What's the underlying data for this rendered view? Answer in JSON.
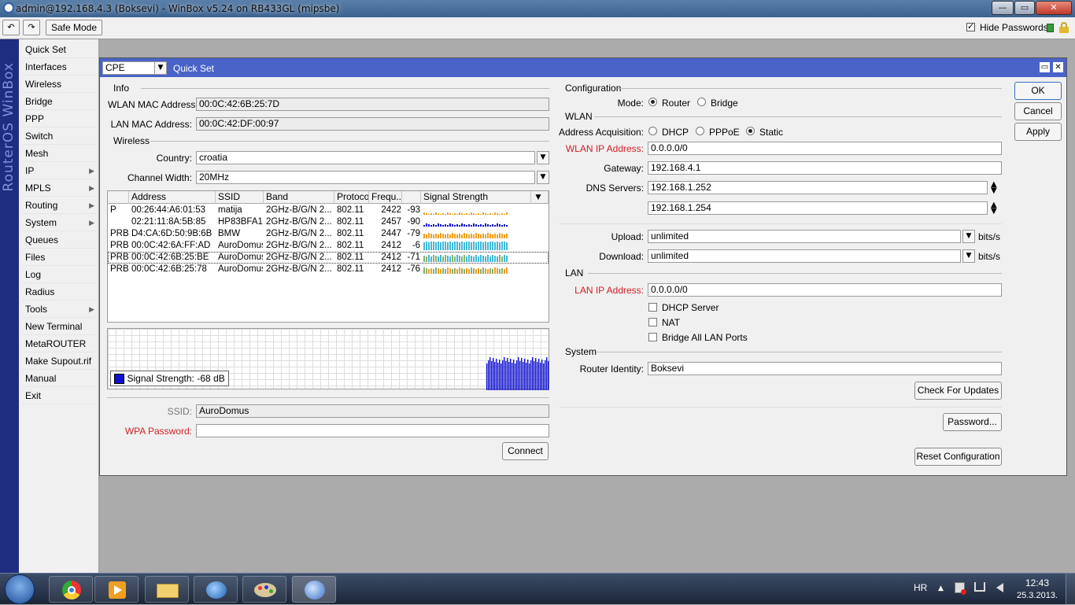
{
  "title_bar": {
    "title": "admin@192.168.4.3 (Boksevi) - WinBox v5.24 on RB433GL (mipsbe)"
  },
  "toolbar": {
    "undo_icon": "undo-icon",
    "redo_icon": "redo-icon",
    "safe_mode": "Safe Mode",
    "hide_passwords": "Hide Passwords",
    "hide_passwords_checked": true
  },
  "side_strip": {
    "brand": "RouterOS WinBox"
  },
  "sidebar": {
    "items": [
      {
        "label": "Quick Set",
        "sub": false
      },
      {
        "label": "Interfaces",
        "sub": false
      },
      {
        "label": "Wireless",
        "sub": false
      },
      {
        "label": "Bridge",
        "sub": false
      },
      {
        "label": "PPP",
        "sub": false
      },
      {
        "label": "Switch",
        "sub": false
      },
      {
        "label": "Mesh",
        "sub": false
      },
      {
        "label": "IP",
        "sub": true
      },
      {
        "label": "MPLS",
        "sub": true
      },
      {
        "label": "Routing",
        "sub": true
      },
      {
        "label": "System",
        "sub": true
      },
      {
        "label": "Queues",
        "sub": false
      },
      {
        "label": "Files",
        "sub": false
      },
      {
        "label": "Log",
        "sub": false
      },
      {
        "label": "Radius",
        "sub": false
      },
      {
        "label": "Tools",
        "sub": true
      },
      {
        "label": "New Terminal",
        "sub": false
      },
      {
        "label": "MetaROUTER",
        "sub": false
      },
      {
        "label": "Make Supout.rif",
        "sub": false
      },
      {
        "label": "Manual",
        "sub": false
      },
      {
        "label": "Exit",
        "sub": false
      }
    ]
  },
  "window": {
    "mode_select": "CPE",
    "title": "Quick Set",
    "info": {
      "group": "Info",
      "wlan_mac_label": "WLAN MAC Address:",
      "wlan_mac": "00:0C:42:6B:25:7D",
      "lan_mac_label": "LAN MAC Address:",
      "lan_mac": "00:0C:42:DF:00:97"
    },
    "wireless": {
      "group": "Wireless",
      "country_label": "Country:",
      "country": "croatia",
      "channel_width_label": "Channel Width:",
      "channel_width": "20MHz",
      "columns": [
        "",
        "Address",
        "SSID",
        "Band",
        "Protocol",
        "Frequ...",
        "",
        "Signal Strength"
      ],
      "rows": [
        {
          "flags": "P",
          "address": "00:26:44:A6:01:53",
          "ssid": "matija",
          "band": "2GHz-B/G/N 2...",
          "protocol": "802.11",
          "freq": "2422",
          "signal": "-93",
          "selected": false
        },
        {
          "flags": "",
          "address": "02:21:11:8A:5B:85",
          "ssid": "HP83BFA1",
          "band": "2GHz-B/G/N 2...",
          "protocol": "802.11",
          "freq": "2457",
          "signal": "-90",
          "selected": false
        },
        {
          "flags": "PRB",
          "address": "D4:CA:6D:50:9B:6B",
          "ssid": "BMW",
          "band": "2GHz-B/G/N 2...",
          "protocol": "802.11",
          "freq": "2447",
          "signal": "-79",
          "selected": false
        },
        {
          "flags": "PRB",
          "address": "00:0C:42:6A:FF:AD",
          "ssid": "AuroDomus",
          "band": "2GHz-B/G/N 2...",
          "protocol": "802.11",
          "freq": "2412",
          "signal": "-6",
          "selected": false
        },
        {
          "flags": "PRB",
          "address": "00:0C:42:6B:25:BE",
          "ssid": "AuroDomus",
          "band": "2GHz-B/G/N 2...",
          "protocol": "802.11",
          "freq": "2412",
          "signal": "-71",
          "selected": true
        },
        {
          "flags": "PRB",
          "address": "00:0C:42:6B:25:78",
          "ssid": "AuroDomus",
          "band": "2GHz-B/G/N 2...",
          "protocol": "802.11",
          "freq": "2412",
          "signal": "-76",
          "selected": false
        }
      ],
      "signal_legend": "Signal Strength:",
      "signal_value": "-68 dB",
      "ssid_label": "SSID:",
      "ssid": "AuroDomus",
      "wpa_label": "WPA Password:",
      "wpa_password": "",
      "connect": "Connect"
    },
    "configuration": {
      "group": "Configuration",
      "mode_label": "Mode:",
      "mode_router": "Router",
      "mode_bridge": "Bridge",
      "mode_selected": "Router"
    },
    "wlan": {
      "group": "WLAN",
      "acq_label": "Address Acquisition:",
      "acq_dhcp": "DHCP",
      "acq_pppoe": "PPPoE",
      "acq_static": "Static",
      "acq_selected": "Static",
      "ip_label": "WLAN IP Address:",
      "ip": "0.0.0.0/0",
      "gateway_label": "Gateway:",
      "gateway": "192.168.4.1",
      "dns_label": "DNS Servers:",
      "dns1": "192.168.1.252",
      "dns2": "192.168.1.254",
      "upload_label": "Upload:",
      "upload": "unlimited",
      "download_label": "Download:",
      "download": "unlimited",
      "unit": "bits/s"
    },
    "lan": {
      "group": "LAN",
      "ip_label": "LAN IP Address:",
      "ip": "0.0.0.0/0",
      "dhcp_server": "DHCP Server",
      "nat": "NAT",
      "bridge_all": "Bridge All LAN Ports"
    },
    "system": {
      "group": "System",
      "identity_label": "Router Identity:",
      "identity": "Boksevi",
      "check_updates": "Check For Updates",
      "password": "Password...",
      "reset": "Reset Configuration"
    },
    "buttons": {
      "ok": "OK",
      "cancel": "Cancel",
      "apply": "Apply"
    }
  },
  "taskbar": {
    "lang": "HR",
    "time": "12:43",
    "date": "25.3.2013.",
    "apps": [
      "chrome-icon",
      "media-player-icon",
      "file-explorer-icon",
      "thunderbird-icon",
      "paint-icon",
      "winbox-icon"
    ]
  },
  "colors": {
    "window_title": "#4a63c8",
    "side_strip": "#1e2d80",
    "signal_blue": "#1010d0",
    "signal_orange": "#f0a020",
    "signal_cyan": "#40b8d8",
    "signal_green": "#88b070"
  }
}
